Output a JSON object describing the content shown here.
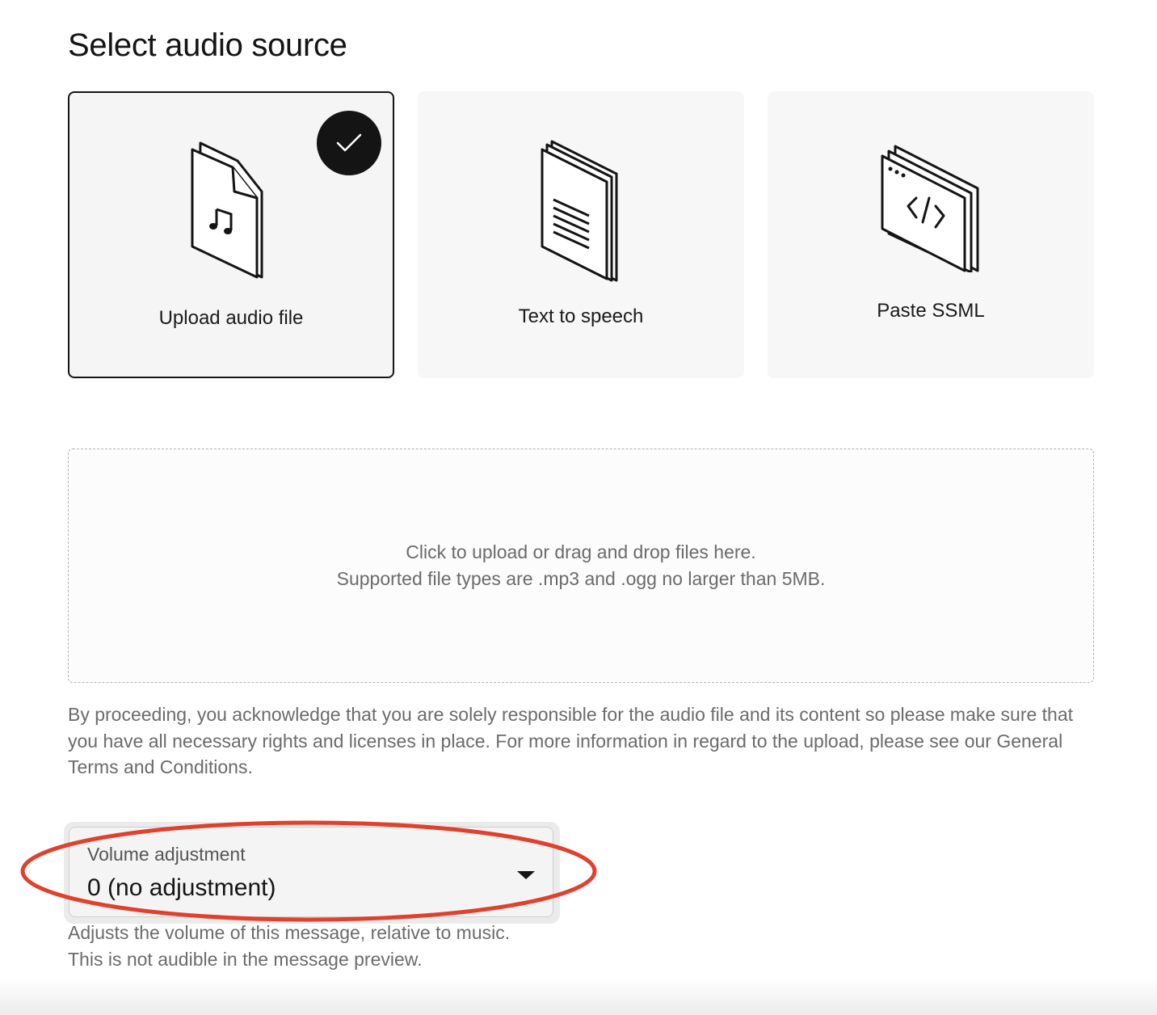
{
  "header": {
    "title": "Select audio source"
  },
  "sources": [
    {
      "label": "Upload audio file",
      "icon": "audio-file-icon",
      "selected": true
    },
    {
      "label": "Text to speech",
      "icon": "text-document-icon",
      "selected": false
    },
    {
      "label": "Paste SSML",
      "icon": "code-window-icon",
      "selected": false
    }
  ],
  "dropzone": {
    "line1": "Click to upload or drag and drop files here.",
    "line2": "Supported file types are .mp3 and .ogg no larger than 5MB."
  },
  "disclaimer": "By proceeding, you acknowledge that you are solely responsible for the audio file and its content so please make sure that you have all necessary rights and licenses in place. For more information in regard to the upload, please see our General Terms and Conditions.",
  "volume": {
    "label": "Volume adjustment",
    "value": "0 (no adjustment)",
    "helper_line1": "Adjusts the volume of this message, relative to music.",
    "helper_line2": "This is not audible in the message preview."
  },
  "colors": {
    "highlight": "#e0402c",
    "selected_border": "#141414",
    "card_background": "#f7f7f7"
  }
}
